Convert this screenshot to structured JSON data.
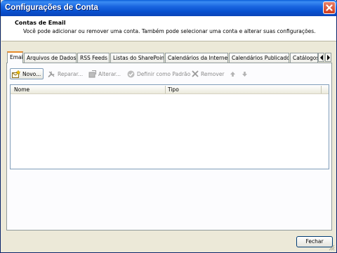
{
  "window": {
    "title": "Configurações de Conta",
    "close_icon": "close-icon"
  },
  "header": {
    "title": "Contas de Email",
    "description": "Você pode adicionar ou remover uma conta. Também pode selecionar uma conta e alterar suas configurações."
  },
  "tabs": [
    {
      "label": "Email",
      "active": true
    },
    {
      "label": "Arquivos de Dados",
      "active": false
    },
    {
      "label": "RSS Feeds",
      "active": false
    },
    {
      "label": "Listas do SharePoint",
      "active": false
    },
    {
      "label": "Calendários da Internet",
      "active": false
    },
    {
      "label": "Calendários Publicados",
      "active": false
    },
    {
      "label": "Catálogos",
      "active": false
    }
  ],
  "toolbar": {
    "new_label": "Novo...",
    "repair_label": "Reparar...",
    "change_label": "Alterar...",
    "default_label": "Definir como Padrão",
    "remove_label": "Remover"
  },
  "list": {
    "columns": [
      "Nome",
      "Tipo"
    ],
    "rows": []
  },
  "footer": {
    "close_label": "Fechar"
  },
  "colors": {
    "titlebar": "#0851d0",
    "active_tab_accent": "#e68b2c",
    "dialog_bg": "#ece9d8"
  }
}
